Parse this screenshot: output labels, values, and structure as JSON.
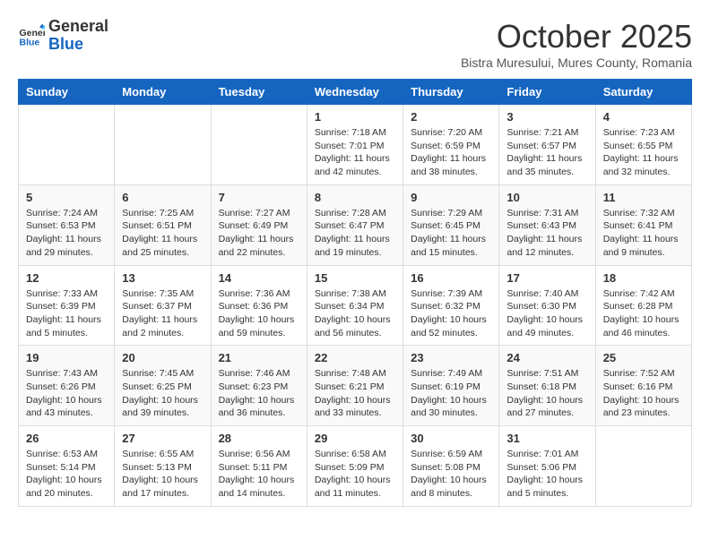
{
  "header": {
    "logo": {
      "general": "General",
      "blue": "Blue"
    },
    "title": "October 2025",
    "subtitle": "Bistra Muresului, Mures County, Romania"
  },
  "days_of_week": [
    "Sunday",
    "Monday",
    "Tuesday",
    "Wednesday",
    "Thursday",
    "Friday",
    "Saturday"
  ],
  "weeks": [
    [
      {
        "day": "",
        "info": ""
      },
      {
        "day": "",
        "info": ""
      },
      {
        "day": "",
        "info": ""
      },
      {
        "day": "1",
        "info": "Sunrise: 7:18 AM\nSunset: 7:01 PM\nDaylight: 11 hours and 42 minutes."
      },
      {
        "day": "2",
        "info": "Sunrise: 7:20 AM\nSunset: 6:59 PM\nDaylight: 11 hours and 38 minutes."
      },
      {
        "day": "3",
        "info": "Sunrise: 7:21 AM\nSunset: 6:57 PM\nDaylight: 11 hours and 35 minutes."
      },
      {
        "day": "4",
        "info": "Sunrise: 7:23 AM\nSunset: 6:55 PM\nDaylight: 11 hours and 32 minutes."
      }
    ],
    [
      {
        "day": "5",
        "info": "Sunrise: 7:24 AM\nSunset: 6:53 PM\nDaylight: 11 hours and 29 minutes."
      },
      {
        "day": "6",
        "info": "Sunrise: 7:25 AM\nSunset: 6:51 PM\nDaylight: 11 hours and 25 minutes."
      },
      {
        "day": "7",
        "info": "Sunrise: 7:27 AM\nSunset: 6:49 PM\nDaylight: 11 hours and 22 minutes."
      },
      {
        "day": "8",
        "info": "Sunrise: 7:28 AM\nSunset: 6:47 PM\nDaylight: 11 hours and 19 minutes."
      },
      {
        "day": "9",
        "info": "Sunrise: 7:29 AM\nSunset: 6:45 PM\nDaylight: 11 hours and 15 minutes."
      },
      {
        "day": "10",
        "info": "Sunrise: 7:31 AM\nSunset: 6:43 PM\nDaylight: 11 hours and 12 minutes."
      },
      {
        "day": "11",
        "info": "Sunrise: 7:32 AM\nSunset: 6:41 PM\nDaylight: 11 hours and 9 minutes."
      }
    ],
    [
      {
        "day": "12",
        "info": "Sunrise: 7:33 AM\nSunset: 6:39 PM\nDaylight: 11 hours and 5 minutes."
      },
      {
        "day": "13",
        "info": "Sunrise: 7:35 AM\nSunset: 6:37 PM\nDaylight: 11 hours and 2 minutes."
      },
      {
        "day": "14",
        "info": "Sunrise: 7:36 AM\nSunset: 6:36 PM\nDaylight: 10 hours and 59 minutes."
      },
      {
        "day": "15",
        "info": "Sunrise: 7:38 AM\nSunset: 6:34 PM\nDaylight: 10 hours and 56 minutes."
      },
      {
        "day": "16",
        "info": "Sunrise: 7:39 AM\nSunset: 6:32 PM\nDaylight: 10 hours and 52 minutes."
      },
      {
        "day": "17",
        "info": "Sunrise: 7:40 AM\nSunset: 6:30 PM\nDaylight: 10 hours and 49 minutes."
      },
      {
        "day": "18",
        "info": "Sunrise: 7:42 AM\nSunset: 6:28 PM\nDaylight: 10 hours and 46 minutes."
      }
    ],
    [
      {
        "day": "19",
        "info": "Sunrise: 7:43 AM\nSunset: 6:26 PM\nDaylight: 10 hours and 43 minutes."
      },
      {
        "day": "20",
        "info": "Sunrise: 7:45 AM\nSunset: 6:25 PM\nDaylight: 10 hours and 39 minutes."
      },
      {
        "day": "21",
        "info": "Sunrise: 7:46 AM\nSunset: 6:23 PM\nDaylight: 10 hours and 36 minutes."
      },
      {
        "day": "22",
        "info": "Sunrise: 7:48 AM\nSunset: 6:21 PM\nDaylight: 10 hours and 33 minutes."
      },
      {
        "day": "23",
        "info": "Sunrise: 7:49 AM\nSunset: 6:19 PM\nDaylight: 10 hours and 30 minutes."
      },
      {
        "day": "24",
        "info": "Sunrise: 7:51 AM\nSunset: 6:18 PM\nDaylight: 10 hours and 27 minutes."
      },
      {
        "day": "25",
        "info": "Sunrise: 7:52 AM\nSunset: 6:16 PM\nDaylight: 10 hours and 23 minutes."
      }
    ],
    [
      {
        "day": "26",
        "info": "Sunrise: 6:53 AM\nSunset: 5:14 PM\nDaylight: 10 hours and 20 minutes."
      },
      {
        "day": "27",
        "info": "Sunrise: 6:55 AM\nSunset: 5:13 PM\nDaylight: 10 hours and 17 minutes."
      },
      {
        "day": "28",
        "info": "Sunrise: 6:56 AM\nSunset: 5:11 PM\nDaylight: 10 hours and 14 minutes."
      },
      {
        "day": "29",
        "info": "Sunrise: 6:58 AM\nSunset: 5:09 PM\nDaylight: 10 hours and 11 minutes."
      },
      {
        "day": "30",
        "info": "Sunrise: 6:59 AM\nSunset: 5:08 PM\nDaylight: 10 hours and 8 minutes."
      },
      {
        "day": "31",
        "info": "Sunrise: 7:01 AM\nSunset: 5:06 PM\nDaylight: 10 hours and 5 minutes."
      },
      {
        "day": "",
        "info": ""
      }
    ]
  ]
}
